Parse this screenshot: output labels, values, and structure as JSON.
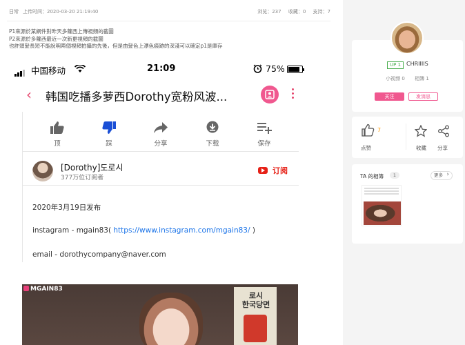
{
  "post": {
    "category": "日常",
    "upload_time": "上传时间：2020-03-20 21:19:40",
    "views": "浏览：237",
    "favorites": "收藏：0",
    "supports": "支持：7",
    "description": [
      "P1來源於某網件對昨天多蘿西上傳視頻的截圖",
      "P2來源於多蘿西最近一次新更視頻的截圖",
      "也許頭髮長短不能說明兩個視頻拍攝的先後，但是由髮色上漂色痕跡的深淺可以確定p1是庫存"
    ]
  },
  "screenshot": {
    "status": {
      "carrier": "中国移动",
      "time": "21:09",
      "battery": "75%"
    },
    "video_title": "韩国吃播多萝西Dorothy宽粉风波...",
    "actions": [
      {
        "label": "顶",
        "icon": "thumbs-up-icon"
      },
      {
        "label": "踩",
        "icon": "thumbs-down-icon"
      },
      {
        "label": "分享",
        "icon": "share-arrow-icon"
      },
      {
        "label": "下载",
        "icon": "download-icon"
      },
      {
        "label": "保存",
        "icon": "save-playlist-icon"
      }
    ],
    "channel": {
      "name": "[Dorothy]도로시",
      "subscribers": "377万位订阅者",
      "subscribe": "订阅"
    },
    "published": "2020年3月19日发布",
    "instagram_prefix": "instagram - mgain83(  ",
    "instagram_url": "https://www.instagram.com/mgain83/",
    "instagram_suffix": " )",
    "email": "email - dorothycompany@naver.com",
    "thumb_logo": "MGAIN83",
    "package_text": "로시\n한국당면"
  },
  "author": {
    "badge": "UP 1",
    "name": "CHRIIIIS",
    "videos": "小视频 0",
    "albums": "相簿 1",
    "follow": "关注",
    "message": "发消息"
  },
  "engage": {
    "like_count": "7",
    "like_label": "点赞",
    "fav_label": "收藏",
    "share_label": "分享"
  },
  "album": {
    "title": "TA 的相簿",
    "count": "1",
    "more": "更多"
  }
}
